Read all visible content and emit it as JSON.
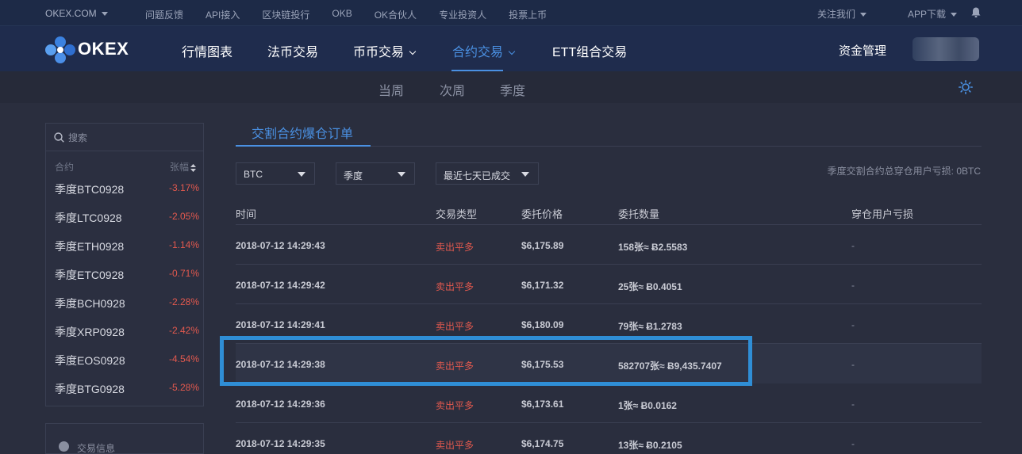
{
  "topbar": {
    "brand": "OKEX.COM",
    "links": [
      "问题反馈",
      "API接入",
      "区块链投行",
      "OKB",
      "OK合伙人",
      "专业投资人",
      "投票上币"
    ],
    "follow": "关注我们",
    "app": "APP下载"
  },
  "nav": {
    "logo": "OKEX",
    "items": [
      "行情图表",
      "法币交易",
      "币币交易",
      "合约交易",
      "ETT组合交易"
    ],
    "active": "合约交易",
    "fund": "资金管理"
  },
  "periods": [
    "当周",
    "次周",
    "季度"
  ],
  "sidebar": {
    "search_placeholder": "搜索",
    "col_contract": "合约",
    "col_change": "张幅",
    "items": [
      {
        "name": "季度BTC0928",
        "change": "-3.17%"
      },
      {
        "name": "季度LTC0928",
        "change": "-2.05%"
      },
      {
        "name": "季度ETH0928",
        "change": "-1.14%"
      },
      {
        "name": "季度ETC0928",
        "change": "-0.71%"
      },
      {
        "name": "季度BCH0928",
        "change": "-2.28%"
      },
      {
        "name": "季度XRP0928",
        "change": "-2.42%"
      },
      {
        "name": "季度EOS0928",
        "change": "-4.54%"
      },
      {
        "name": "季度BTG0928",
        "change": "-5.28%"
      }
    ],
    "info_label": "交易信息"
  },
  "content": {
    "tab": "交割合约爆仓订单",
    "filters": {
      "coin": "BTC",
      "period": "季度",
      "range": "最近七天已成交"
    },
    "summary": "季度交割合约总穿仓用户亏损: 0BTC",
    "headers": [
      "时间",
      "交易类型",
      "委托价格",
      "委托数量",
      "穿仓用户亏损"
    ],
    "rows": [
      {
        "time": "2018-07-12 14:29:43",
        "type": "卖出平多",
        "price": "$6,175.89",
        "qty": "158张≈ Ƀ2.5583",
        "loss": "-"
      },
      {
        "time": "2018-07-12 14:29:42",
        "type": "卖出平多",
        "price": "$6,171.32",
        "qty": "25张≈ Ƀ0.4051",
        "loss": "-"
      },
      {
        "time": "2018-07-12 14:29:41",
        "type": "卖出平多",
        "price": "$6,180.09",
        "qty": "79张≈ Ƀ1.2783",
        "loss": "-"
      },
      {
        "time": "2018-07-12 14:29:38",
        "type": "卖出平多",
        "price": "$6,175.53",
        "qty": "582707张≈ Ƀ9,435.7407",
        "loss": "-"
      },
      {
        "time": "2018-07-12 14:29:36",
        "type": "卖出平多",
        "price": "$6,173.61",
        "qty": "1张≈ Ƀ0.0162",
        "loss": "-"
      },
      {
        "time": "2018-07-12 14:29:35",
        "type": "卖出平多",
        "price": "$6,174.75",
        "qty": "13张≈ Ƀ0.2105",
        "loss": "-"
      }
    ]
  },
  "colors": {
    "accent": "#4a90e2",
    "negative": "#e3594e",
    "highlight_box": "#2f8ed6"
  }
}
